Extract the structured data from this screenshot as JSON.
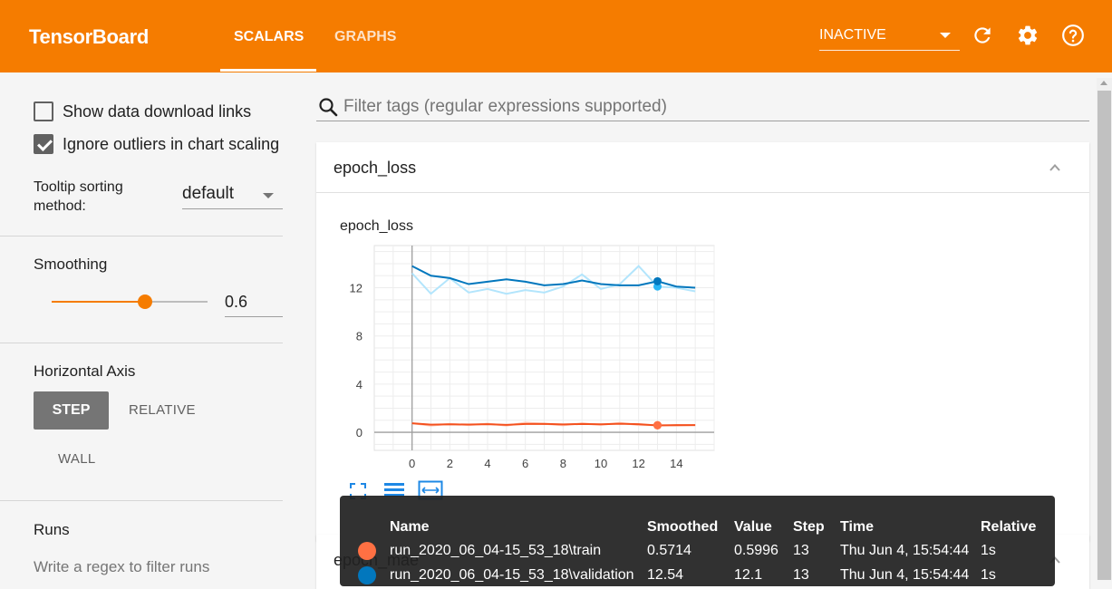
{
  "header": {
    "brand": "TensorBoard",
    "tabs": [
      {
        "label": "SCALARS",
        "active": true
      },
      {
        "label": "GRAPHS",
        "active": false
      }
    ],
    "status": "INACTIVE",
    "bg_color": "#f57c00",
    "icons": [
      "refresh-icon",
      "settings-gear-icon",
      "help-icon"
    ]
  },
  "sidebar": {
    "show_download_label": "Show data download links",
    "show_download_checked": false,
    "ignore_outliers_label": "Ignore outliers in chart scaling",
    "ignore_outliers_checked": true,
    "tooltip_sort_label": "Tooltip sorting method:",
    "tooltip_sort_value": "default",
    "smoothing_label": "Smoothing",
    "smoothing_value": "0.6",
    "smoothing_fraction": 0.6,
    "horizontal_axis_label": "Horizontal Axis",
    "axis_options": [
      "STEP",
      "RELATIVE",
      "WALL"
    ],
    "axis_selected": "STEP",
    "runs_label": "Runs",
    "runs_filter_placeholder": "Write a regex to filter runs"
  },
  "main": {
    "filter_placeholder": "Filter tags (regular expressions supported)",
    "card_title": "epoch_loss",
    "chart_title": "epoch_loss",
    "next_card_title": "epoch_mae"
  },
  "chart_data": {
    "type": "line",
    "title": "epoch_loss",
    "xlabel": "",
    "ylabel": "",
    "xlim": [
      -2,
      16
    ],
    "ylim": [
      -1.5,
      15.5
    ],
    "x_ticks": [
      0,
      2,
      4,
      6,
      8,
      10,
      12,
      14
    ],
    "y_ticks": [
      0,
      4,
      8,
      12
    ],
    "grid": true,
    "hover_step": 13,
    "series": [
      {
        "name": "run_2020_06_04-15_53_18\\train",
        "color": "#ff7043",
        "x": [
          0,
          1,
          2,
          3,
          4,
          5,
          6,
          7,
          8,
          9,
          10,
          11,
          12,
          13,
          14,
          15
        ],
        "raw": [
          0.75,
          0.55,
          0.7,
          0.6,
          0.72,
          0.55,
          0.8,
          0.7,
          0.58,
          0.75,
          0.62,
          0.78,
          0.6,
          0.5996,
          0.55,
          0.6
        ],
        "smoothed": [
          0.75,
          0.63,
          0.66,
          0.64,
          0.67,
          0.62,
          0.69,
          0.7,
          0.65,
          0.69,
          0.66,
          0.71,
          0.67,
          0.5714,
          0.6,
          0.6
        ]
      },
      {
        "name": "run_2020_06_04-15_53_18\\validation",
        "color": "#0277bd",
        "x": [
          0,
          1,
          2,
          3,
          4,
          5,
          6,
          7,
          8,
          9,
          10,
          11,
          12,
          13,
          14,
          15
        ],
        "raw": [
          13.2,
          11.5,
          12.8,
          11.6,
          11.9,
          11.5,
          11.8,
          11.6,
          12.1,
          13.1,
          11.9,
          12.3,
          13.8,
          12.1,
          12.0,
          11.7
        ],
        "smoothed": [
          13.8,
          13.0,
          12.8,
          12.3,
          12.5,
          12.7,
          12.5,
          12.2,
          12.3,
          12.6,
          12.3,
          12.2,
          12.2,
          12.54,
          12.1,
          12.0
        ]
      }
    ]
  },
  "tooltip": {
    "headers": [
      "Name",
      "Smoothed",
      "Value",
      "Step",
      "Time",
      "Relative"
    ],
    "rows": [
      {
        "color": "#ff7043",
        "name": "run_2020_06_04-15_53_18\\train",
        "smoothed": "0.5714",
        "value": "0.5996",
        "step": "13",
        "time": "Thu Jun 4, 15:54:44",
        "relative": "1s"
      },
      {
        "color": "#0277bd",
        "name": "run_2020_06_04-15_53_18\\validation",
        "smoothed": "12.54",
        "value": "12.1",
        "step": "13",
        "time": "Thu Jun 4, 15:54:44",
        "relative": "1s"
      }
    ]
  }
}
